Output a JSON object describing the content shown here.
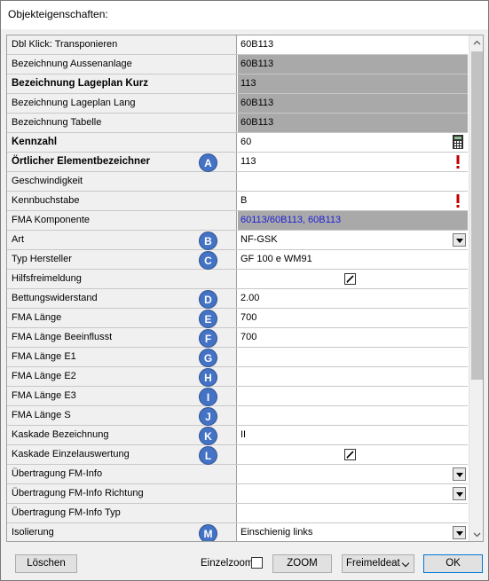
{
  "window": {
    "title": "Objekteigenschaften:"
  },
  "rows": [
    {
      "label": "Dbl Klick: Transponieren",
      "value": "60B113",
      "bold": false,
      "gray": false
    },
    {
      "label": "Bezeichnung Aussenanlage",
      "value": "60B113",
      "bold": false,
      "gray": true
    },
    {
      "label": "Bezeichnung Lageplan Kurz",
      "value": "113",
      "bold": true,
      "gray": true
    },
    {
      "label": "Bezeichnung Lageplan Lang",
      "value": "60B113",
      "bold": false,
      "gray": true
    },
    {
      "label": "Bezeichnung Tabelle",
      "value": "60B113",
      "bold": false,
      "gray": true
    },
    {
      "label": "Kennzahl",
      "value": "60",
      "bold": true,
      "icon": "calculator-icon"
    },
    {
      "label": "Örtlicher Elementbezeichner",
      "value": "113",
      "bold": true,
      "badge": "A",
      "icon": "exclamation-icon"
    },
    {
      "label": "Geschwindigkeit",
      "value": ""
    },
    {
      "label": "Kennbuchstabe",
      "value": "B",
      "icon": "exclamation-icon"
    },
    {
      "label": "FMA Komponente",
      "value": "60113/60B113, 60B113",
      "gray": true,
      "blue": true
    },
    {
      "label": "Art",
      "value": "NF-GSK",
      "badge": "B",
      "dropdown": true
    },
    {
      "label": "Typ Hersteller",
      "value": "GF 100 e WM91",
      "badge": "C"
    },
    {
      "label": "Hilfsfreimeldung",
      "value": "",
      "checkbox": true
    },
    {
      "label": "Bettungswiderstand",
      "value": "2.00",
      "badge": "D"
    },
    {
      "label": "FMA Länge",
      "value": "700",
      "badge": "E"
    },
    {
      "label": "FMA Länge Beeinflusst",
      "value": "700",
      "badge": "F"
    },
    {
      "label": "FMA Länge E1",
      "value": "",
      "badge": "G"
    },
    {
      "label": "FMA Länge E2",
      "value": "",
      "badge": "H"
    },
    {
      "label": "FMA Länge E3",
      "value": "",
      "badge": "I"
    },
    {
      "label": "FMA Länge S",
      "value": "",
      "badge": "J"
    },
    {
      "label": "Kaskade Bezeichnung",
      "value": "II",
      "badge": "K"
    },
    {
      "label": "Kaskade Einzelauswertung",
      "value": "",
      "badge": "L",
      "checkbox": true
    },
    {
      "label": "Übertragung FM-Info",
      "value": "",
      "dropdown": true
    },
    {
      "label": "Übertragung FM-Info Richtung",
      "value": "",
      "dropdown": true
    },
    {
      "label": "Übertragung FM-Info Typ",
      "value": ""
    },
    {
      "label": "Isolierung",
      "value": "Einschienig links",
      "badge": "M",
      "dropdown": true
    }
  ],
  "footer": {
    "delete_label": "Löschen",
    "single_zoom_label": "Einzelzoom",
    "zoom_label": "ZOOM",
    "select_value": "Freimeldeat",
    "ok_label": "OK"
  },
  "colors": {
    "badge": "#4472c4",
    "gray_cell": "#a9a9a9",
    "link_text": "#1f1fd6"
  }
}
